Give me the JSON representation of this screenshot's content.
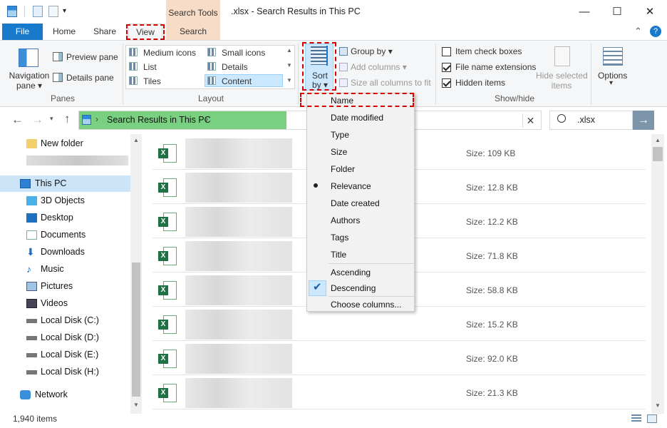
{
  "window": {
    "title": ".xlsx - Search Results in This PC",
    "minimize": "—",
    "maximize": "☐",
    "close": "✕"
  },
  "ribbon_tabs": {
    "file": "File",
    "home": "Home",
    "share": "Share",
    "view": "View",
    "search": "Search",
    "search_tools": "Search Tools"
  },
  "ribbon": {
    "panes": {
      "navigation_pane": "Navigation",
      "navigation_pane_2": "pane ▾",
      "preview_pane": "Preview pane",
      "details_pane": "Details pane",
      "group_label": "Panes"
    },
    "layout": {
      "medium_icons": "Medium icons",
      "small_icons": "Small icons",
      "list": "List",
      "details": "Details",
      "tiles": "Tiles",
      "content": "Content",
      "group_label": "Layout"
    },
    "current_view": {
      "sort_by_1": "Sort",
      "sort_by_2": "by ▾",
      "group_by": "Group by ▾",
      "add_columns": "Add columns ▾",
      "size_all_columns": "Size all columns to fit"
    },
    "show_hide": {
      "item_check_boxes": "Item check boxes",
      "file_name_extensions": "File name extensions",
      "hidden_items": "Hidden items",
      "hide_selected_1": "Hide selected",
      "hide_selected_2": "items",
      "options": "Options",
      "options_arrow": "▾",
      "group_label": "Show/hide",
      "item_check_boxes_checked": false,
      "file_name_extensions_checked": true,
      "hidden_items_checked": true
    }
  },
  "address": {
    "path": "Search Results in This PC",
    "search_value": ".xlsx"
  },
  "nav": {
    "new_folder": "New folder",
    "this_pc": "This PC",
    "objects3d": "3D Objects",
    "desktop": "Desktop",
    "documents": "Documents",
    "downloads": "Downloads",
    "music": "Music",
    "pictures": "Pictures",
    "videos": "Videos",
    "disk_c": "Local Disk (C:)",
    "disk_d": "Local Disk (D:)",
    "disk_e": "Local Disk (E:)",
    "disk_h": "Local Disk (H:)",
    "network": "Network"
  },
  "files": [
    {
      "size": "Size: 109 KB"
    },
    {
      "size": "Size: 12.8 KB"
    },
    {
      "size": "Size: 12.2 KB"
    },
    {
      "size": "Size: 71.8 KB"
    },
    {
      "size": "Size: 58.8 KB"
    },
    {
      "size": "Size: 15.2 KB"
    },
    {
      "size": "Size: 92.0 KB"
    },
    {
      "size": "Size: 21.3 KB"
    }
  ],
  "status": {
    "item_count": "1,940 items"
  },
  "sort_menu": {
    "name": "Name",
    "date_modified": "Date modified",
    "type": "Type",
    "size": "Size",
    "folder": "Folder",
    "relevance": "Relevance",
    "date_created": "Date created",
    "authors": "Authors",
    "tags": "Tags",
    "title": "Title",
    "ascending": "Ascending",
    "descending": "Descending",
    "choose_columns": "Choose columns...",
    "selected_sort": "Relevance",
    "selected_order": "Descending"
  },
  "colors": {
    "accent": "#1979ca",
    "highlight": "#d40000",
    "address_green": "#78d080",
    "search_tools": "#f7dcc8"
  }
}
